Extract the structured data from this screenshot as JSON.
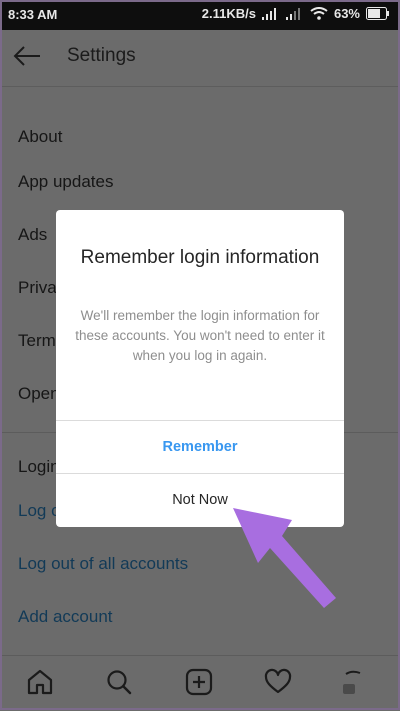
{
  "status_bar": {
    "time": "8:33 AM",
    "speed": "2.11KB/s",
    "battery": "63%",
    "icons": [
      "signal-icon",
      "wifi-icon",
      "battery-icon"
    ]
  },
  "header": {
    "title": "Settings",
    "back_icon": "arrow-left-icon"
  },
  "settings": {
    "about_header": "About",
    "items": [
      "App updates",
      "Ads",
      "Privacy",
      "Terms",
      "Open"
    ],
    "logins_header": "Logins",
    "login_links": [
      "Log out",
      "Log out of all accounts",
      "Add account"
    ]
  },
  "dialog": {
    "title": "Remember login information",
    "message": "We'll remember the login information for these accounts. You won't need to enter it when you log in again.",
    "remember_label": "Remember",
    "not_now_label": "Not Now"
  },
  "bottom_nav": {
    "icons": [
      "home-icon",
      "search-icon",
      "add-post-icon",
      "heart-icon",
      "profile-icon"
    ]
  },
  "colors": {
    "accent_blue": "#3897f0",
    "arrow_purple": "#a86ee0",
    "overlay_gray": "#6b6b6b"
  }
}
